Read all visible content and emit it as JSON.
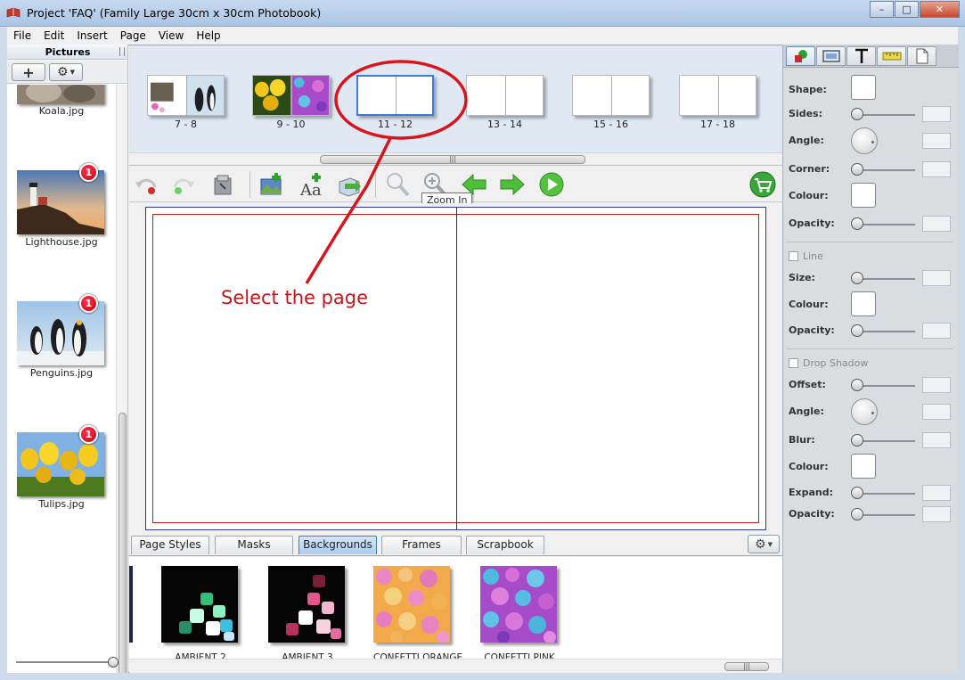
{
  "window": {
    "title": "Project 'FAQ' (Family Large 30cm x 30cm Photobook)"
  },
  "menu": [
    "File",
    "Edit",
    "Insert",
    "Page",
    "View",
    "Help"
  ],
  "pictures_panel": {
    "header": "Pictures",
    "items": [
      {
        "label": "Koala.jpg",
        "badge": ""
      },
      {
        "label": "Lighthouse.jpg",
        "badge": "1"
      },
      {
        "label": "Penguins.jpg",
        "badge": "1"
      },
      {
        "label": "Tulips.jpg",
        "badge": "1"
      }
    ]
  },
  "page_strip": {
    "spreads": [
      {
        "label": "7 - 8"
      },
      {
        "label": "9 - 10"
      },
      {
        "label": "11 - 12",
        "selected": true
      },
      {
        "label": "13 - 14"
      },
      {
        "label": "15 - 16"
      },
      {
        "label": "17 - 18"
      }
    ]
  },
  "toolbar": {
    "tooltip": "Zoom In"
  },
  "annotation": {
    "text": "Select the page"
  },
  "tabs": [
    "Page Styles",
    "Masks",
    "Backgrounds",
    "Frames",
    "Scrapbook"
  ],
  "active_tab": "Backgrounds",
  "backgrounds": [
    {
      "label": "AMBIENT 2"
    },
    {
      "label": "AMBIENT 3"
    },
    {
      "label": "CONFETTI ORANGE"
    },
    {
      "label": "CONFETTI PINK"
    }
  ],
  "properties": {
    "shape": "Shape:",
    "sides": "Sides:",
    "angle": "Angle:",
    "corner": "Corner:",
    "colour": "Colour:",
    "opacity": "Opacity:",
    "line": "Line",
    "line_size": "Size:",
    "line_colour": "Colour:",
    "line_opacity": "Opacity:",
    "drop_shadow": "Drop Shadow",
    "ds_offset": "Offset:",
    "ds_angle": "Angle:",
    "ds_blur": "Blur:",
    "ds_colour": "Colour:",
    "ds_expand": "Expand:",
    "ds_opacity": "Opacity:"
  },
  "colors": {
    "accent": "#3d7bd6",
    "annotation": "#c4161c",
    "badge": "#e0101e"
  }
}
